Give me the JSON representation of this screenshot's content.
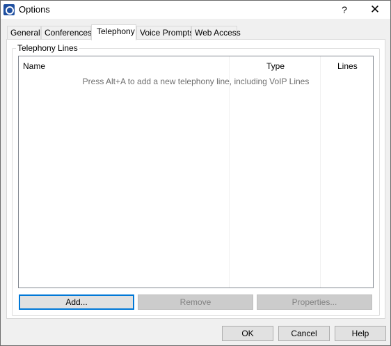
{
  "window": {
    "title": "Options",
    "help_glyph": "?",
    "close_glyph": "✕"
  },
  "tabs": [
    {
      "label": "General"
    },
    {
      "label": "Conferences"
    },
    {
      "label": "Telephony",
      "active": true
    },
    {
      "label": "Voice Prompts"
    },
    {
      "label": "Web Access"
    }
  ],
  "telephony": {
    "group_label": "Telephony Lines",
    "columns": [
      "Name",
      "Type",
      "Lines"
    ],
    "empty_message": "Press Alt+A to add a new telephony line, including VoIP Lines",
    "buttons": {
      "add": "Add...",
      "remove": "Remove",
      "properties": "Properties..."
    }
  },
  "dialog_buttons": {
    "ok": "OK",
    "cancel": "Cancel",
    "help": "Help"
  },
  "colors": {
    "accent": "#0078d7",
    "app_icon": "#1f4fa0"
  },
  "icons": {
    "app": "app-logo-icon",
    "close": "close-icon"
  }
}
